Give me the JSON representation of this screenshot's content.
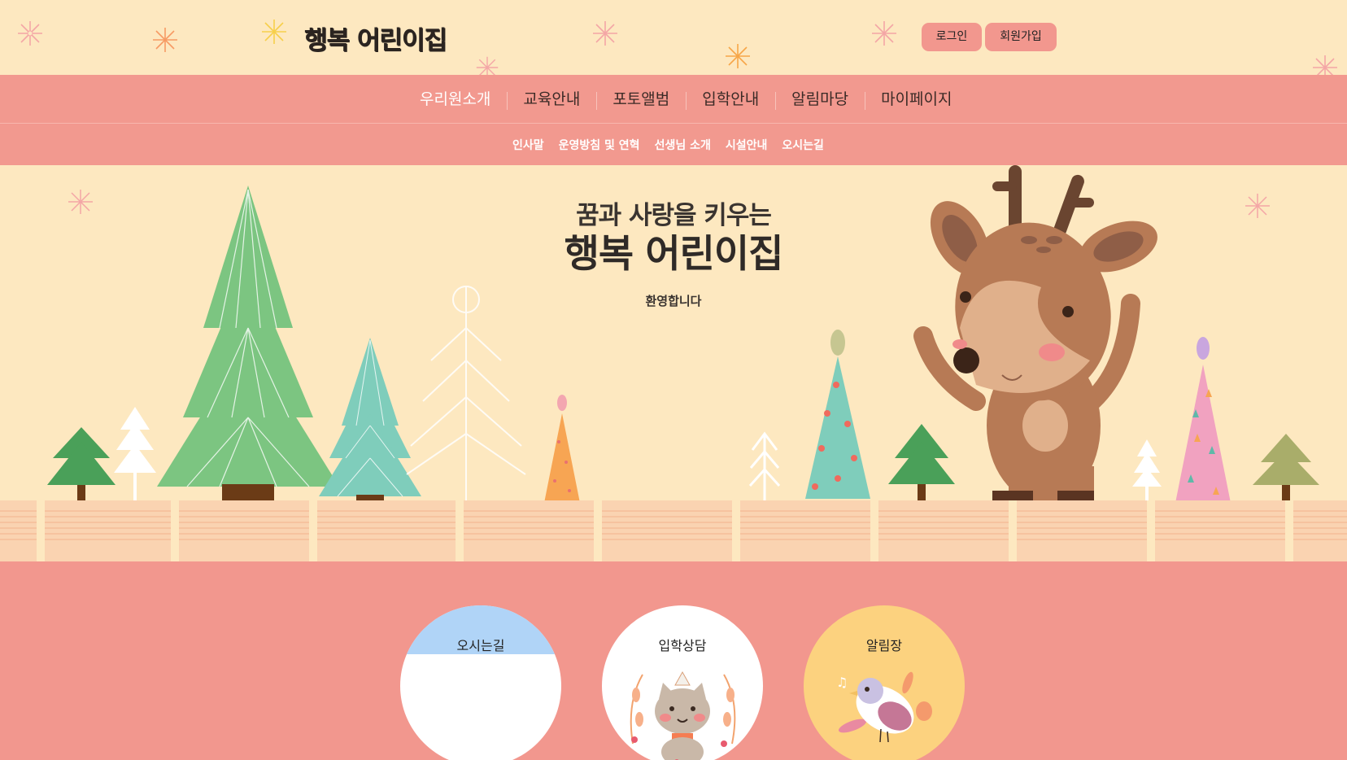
{
  "header": {
    "logo": "행복 어린이집",
    "login_label": "로그인",
    "signup_label": "회원가입"
  },
  "nav": {
    "items": [
      {
        "label": "우리원소개",
        "active": true
      },
      {
        "label": "교육안내"
      },
      {
        "label": "포토앨범"
      },
      {
        "label": "입학안내"
      },
      {
        "label": "알림마당"
      },
      {
        "label": "마이페이지"
      }
    ],
    "sub_items": [
      {
        "label": "인사말"
      },
      {
        "label": "운영방침 및 연혁"
      },
      {
        "label": "선생님 소개"
      },
      {
        "label": "시설안내"
      },
      {
        "label": "오시는길"
      }
    ]
  },
  "hero": {
    "title_line1": "꿈과 사랑을 키우는",
    "title_line2": "행복 어린이집",
    "subtitle": "환영합니다"
  },
  "quick_links": [
    {
      "label": "오시는길",
      "icon": "map-icon"
    },
    {
      "label": "입학상담",
      "icon": "cat-illustration"
    },
    {
      "label": "알림장",
      "icon": "bird-illustration"
    }
  ],
  "colors": {
    "header_bg": "#fde8c0",
    "accent_pink": "#f2978e",
    "sky_blue": "#b0d4f7",
    "yellow": "#fcd27f"
  }
}
